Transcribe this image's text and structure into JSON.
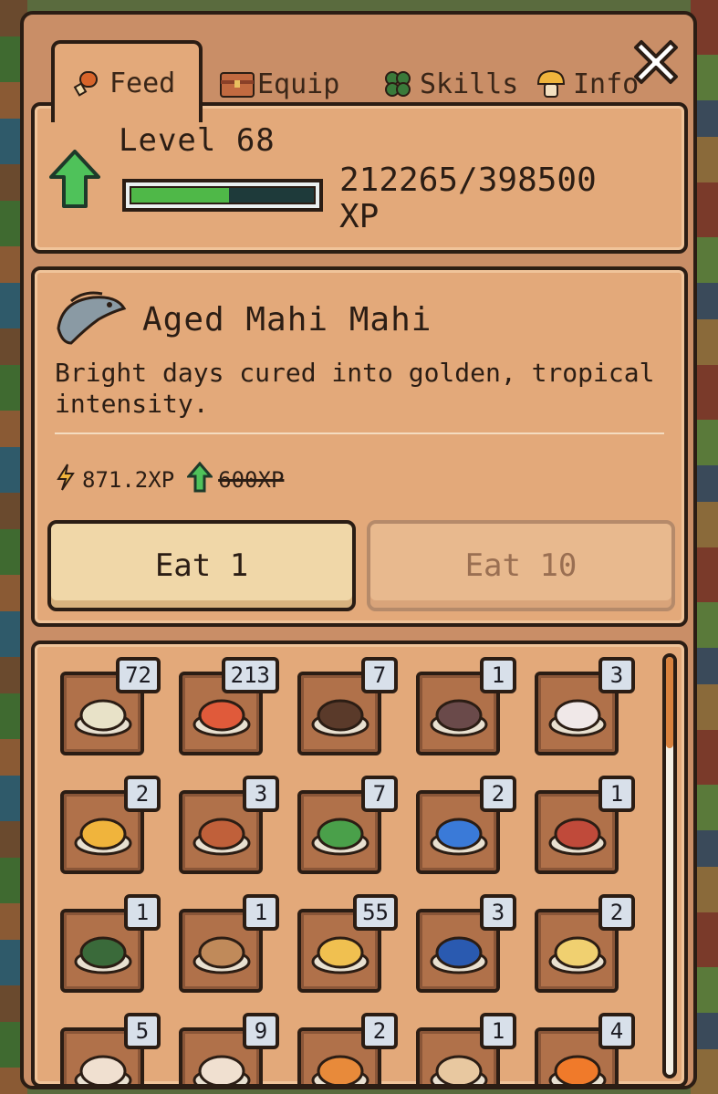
{
  "tabs": [
    {
      "label": "Feed",
      "icon": "drumstick-icon"
    },
    {
      "label": "Equip",
      "icon": "chest-icon"
    },
    {
      "label": "Skills",
      "icon": "clover-icon"
    },
    {
      "label": "Info",
      "icon": "mushroom-icon"
    }
  ],
  "level": {
    "label": "Level 68",
    "xp_current": 212265,
    "xp_max": 398500,
    "xp_text": "212265/398500",
    "xp_unit": "XP"
  },
  "item": {
    "name": "Aged Mahi Mahi",
    "description": "Bright days cured into golden, tropical intensity.",
    "xp_boosted": "871.2XP",
    "xp_base": "600XP"
  },
  "buttons": {
    "eat1": "Eat 1",
    "eat10": "Eat 10"
  },
  "inventory": [
    {
      "count": "72",
      "icon": "mashed-potato-icon"
    },
    {
      "count": "213",
      "icon": "pizza-slice-icon"
    },
    {
      "count": "7",
      "icon": "stew-bowl-icon"
    },
    {
      "count": "1",
      "icon": "soup-bowl-icon"
    },
    {
      "count": "3",
      "icon": "ham-bowl-icon"
    },
    {
      "count": "2",
      "icon": "pizza-icon"
    },
    {
      "count": "3",
      "icon": "meat-pie-icon"
    },
    {
      "count": "7",
      "icon": "salad-icon"
    },
    {
      "count": "2",
      "icon": "fish-plate-icon"
    },
    {
      "count": "1",
      "icon": "fish-board-icon"
    },
    {
      "count": "1",
      "icon": "green-soup-icon"
    },
    {
      "count": "1",
      "icon": "meat-plate-icon"
    },
    {
      "count": "55",
      "icon": "cheese-icon"
    },
    {
      "count": "3",
      "icon": "jam-jar-icon"
    },
    {
      "count": "2",
      "icon": "cake-icon"
    },
    {
      "count": "5",
      "icon": "bottle-icon"
    },
    {
      "count": "9",
      "icon": "bottle-icon"
    },
    {
      "count": "2",
      "icon": "fries-icon"
    },
    {
      "count": "1",
      "icon": "potion-icon"
    },
    {
      "count": "4",
      "icon": "orange-drink-icon"
    }
  ],
  "colors": {
    "xp_bar": "#4fb848",
    "panel": "#c98e67",
    "card": "#e3a97a"
  }
}
